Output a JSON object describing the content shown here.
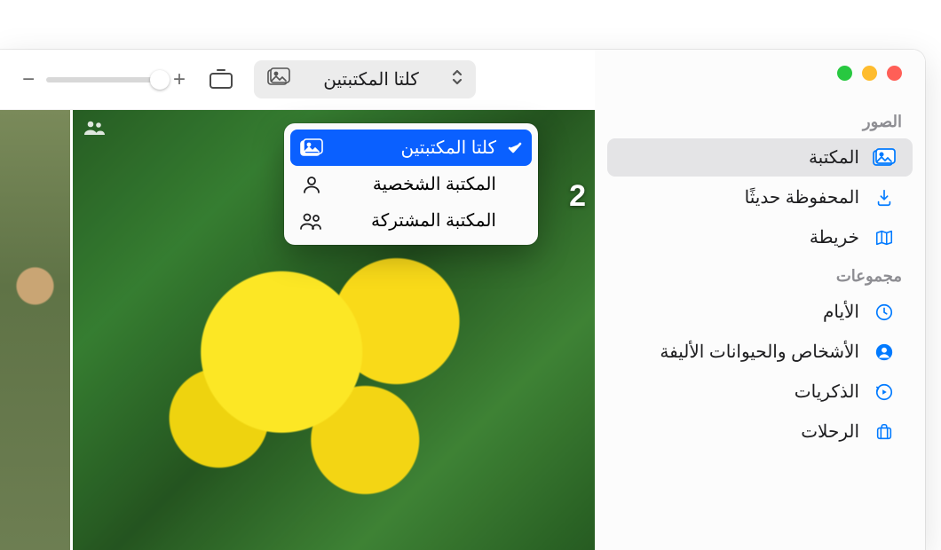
{
  "sidebar": {
    "sections": {
      "photos": {
        "header": "الصور"
      },
      "collections": {
        "header": "مجموعات"
      }
    },
    "items": [
      {
        "label": "المكتبة",
        "icon": "photos-icon",
        "section": "photos",
        "selected": true
      },
      {
        "label": "المحفوظة حديثًا",
        "icon": "download-icon",
        "section": "photos"
      },
      {
        "label": "خريطة",
        "icon": "map-icon",
        "section": "photos"
      },
      {
        "label": "الأيام",
        "icon": "clock-icon",
        "section": "collections"
      },
      {
        "label": "الأشخاص والحيوانات الأليفة",
        "icon": "person-circle-icon",
        "section": "collections"
      },
      {
        "label": "الذكريات",
        "icon": "memories-icon",
        "section": "collections"
      },
      {
        "label": "الرحلات",
        "icon": "suitcase-icon",
        "section": "collections"
      }
    ]
  },
  "toolbar": {
    "zoom": {
      "minus": "−",
      "plus": "+"
    },
    "filter_label": "كلتا المكتبتين"
  },
  "dropdown": {
    "items": [
      {
        "label": "كلتا المكتبتين",
        "icon": "photos-icon",
        "checked": true
      },
      {
        "label": "المكتبة الشخصية",
        "icon": "person-icon",
        "checked": false
      },
      {
        "label": "المكتبة المشتركة",
        "icon": "people-icon",
        "checked": false
      }
    ]
  },
  "content": {
    "year_partial": "2"
  }
}
